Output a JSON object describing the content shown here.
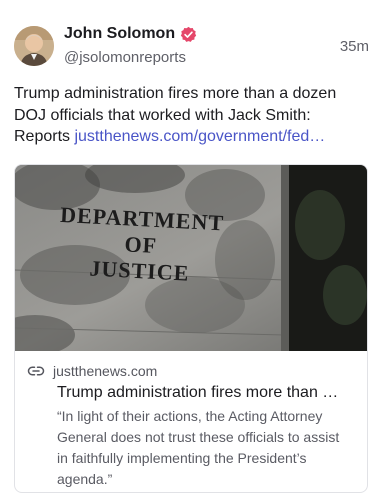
{
  "post": {
    "author": {
      "display_name": "John Solomon",
      "handle": "@jsolomonreports",
      "verified": true,
      "avatar_icon": "avatar-photo"
    },
    "timestamp": "35m",
    "text": "Trump administration fires more than a dozen DOJ officials that worked with Jack Smith: Reports ",
    "link_text": "justthenews.com/government/fed…",
    "colors": {
      "link": "#4a55c7",
      "verified_badge": "#e5476a",
      "secondary_text": "#5f6068"
    }
  },
  "card": {
    "image_sign": {
      "line1": "DEPARTMENT",
      "line2": "OF",
      "line3": "JUSTICE"
    },
    "domain_icon": "link-icon",
    "domain": "justthenews.com",
    "title": "Trump administration fires more than …",
    "description": "“In light of their actions, the Acting Attorney General does not trust these officials to assist in faithfully implementing the President’s agenda.”"
  }
}
